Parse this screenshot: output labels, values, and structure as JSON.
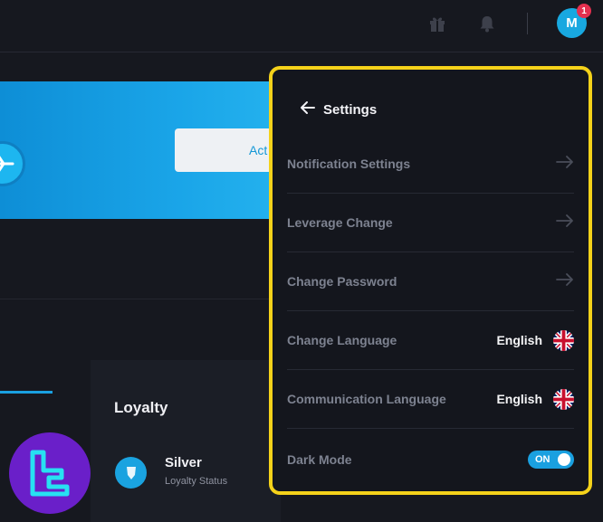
{
  "topbar": {
    "icons": [
      "gift-icon",
      "bell-icon"
    ],
    "avatar_initial": "M",
    "notification_count": "1"
  },
  "banner": {
    "button_label_partial": "Act"
  },
  "loyalty": {
    "title": "Loyalty",
    "level": "Silver",
    "status_label": "Loyalty Status"
  },
  "settings": {
    "title": "Settings",
    "items": [
      {
        "label": "Notification Settings",
        "type": "link"
      },
      {
        "label": "Leverage Change",
        "type": "link"
      },
      {
        "label": "Change Password",
        "type": "link"
      },
      {
        "label": "Change Language",
        "type": "value",
        "value": "English",
        "flag": "uk-flag-icon"
      },
      {
        "label": "Communication Language",
        "type": "value",
        "value": "English",
        "flag": "uk-flag-icon"
      },
      {
        "label": "Dark Mode",
        "type": "toggle",
        "state": "ON"
      }
    ]
  },
  "colors": {
    "accent": "#1aa0e0",
    "highlight_border": "#f5d21a",
    "background": "#16181f",
    "badge": "#e4304f"
  }
}
